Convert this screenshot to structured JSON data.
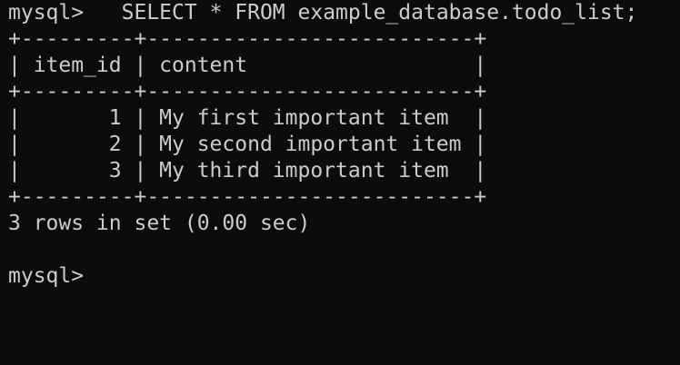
{
  "terminal": {
    "command_prompt": "mysql>",
    "command_text": "   SELECT * FROM example_database.todo_list;",
    "table": {
      "border_top": "+---------+--------------------------+",
      "header": "| item_id | content                  |",
      "border_mid": "+---------+--------------------------+",
      "rows": [
        "|       1 | My first important item  |",
        "|       2 | My second important item |",
        "|       3 | My third important item  |"
      ],
      "border_bottom": "+---------+--------------------------+"
    },
    "result_summary": "3 rows in set (0.00 sec)",
    "final_prompt": "mysql>"
  }
}
